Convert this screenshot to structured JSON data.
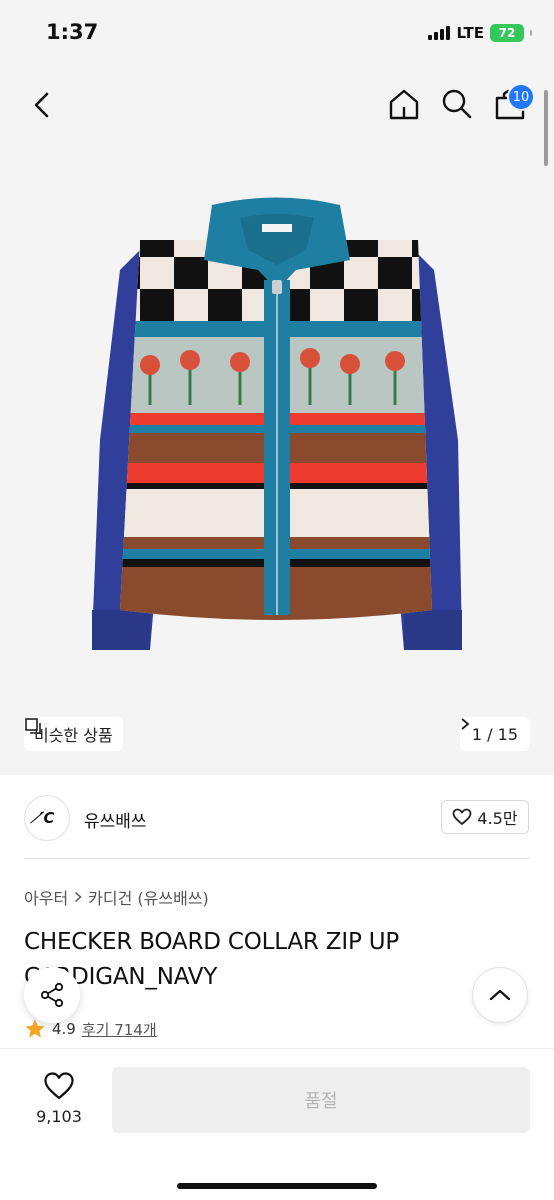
{
  "status_bar": {
    "time": "1:37",
    "network": "LTE",
    "battery": "72"
  },
  "header": {
    "cart_count": "10"
  },
  "hero": {
    "similar_label": "비슷한 상품",
    "pager": "1 / 15"
  },
  "brand": {
    "logo_text": "′̸C",
    "name": "유쓰배쓰",
    "likes": "4.5만"
  },
  "breadcrumb": {
    "category": "아우터",
    "subcategory": "카디건 (유쓰배쓰)"
  },
  "product": {
    "title": "CHECKER BOARD COLLAR ZIP UP CARDIGAN_NAVY",
    "rating": "4.9",
    "reviews": "후기 714개"
  },
  "bottom": {
    "wish_count": "9,103",
    "soldout_label": "품절"
  },
  "colors": {
    "accent_blue": "#1f78ff",
    "star": "#f5a623",
    "sweater_navy": "#2f3f9a",
    "sweater_teal": "#1e7fa3",
    "sweater_red": "#ee3b2f",
    "sweater_brown": "#8a4a2e"
  }
}
